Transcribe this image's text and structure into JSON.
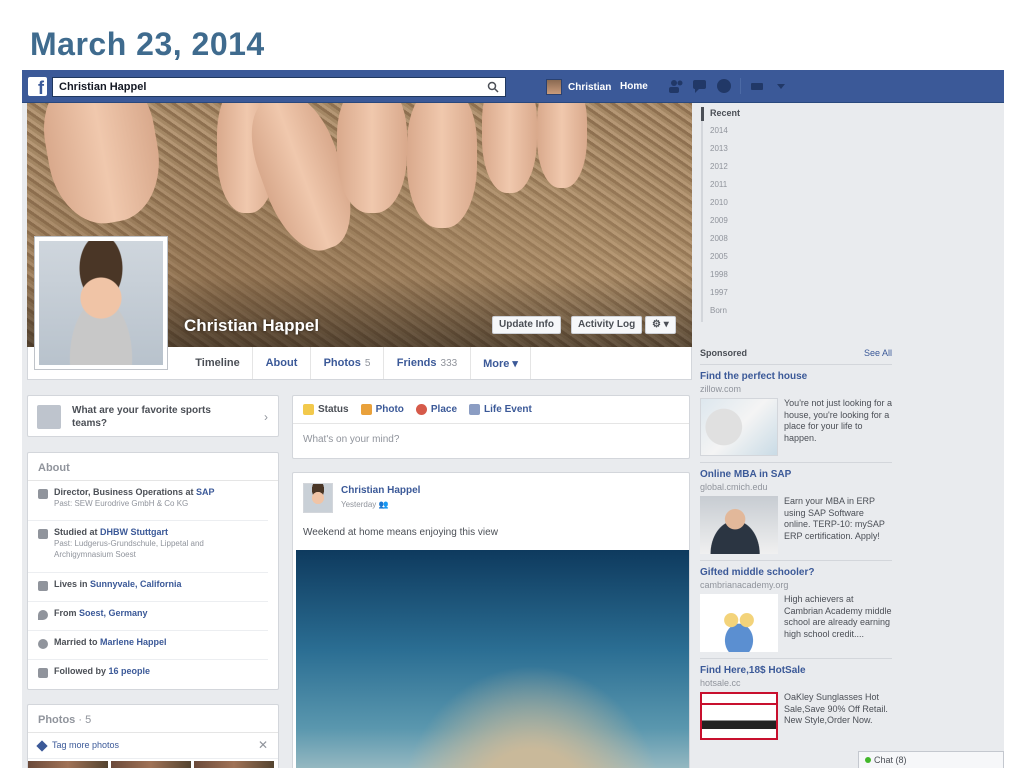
{
  "slide_title": "March 23, 2014",
  "topbar": {
    "logo": "f",
    "search_value": "Christian Happel",
    "user_name": "Christian",
    "home_label": "Home",
    "icons": [
      "friend-requests-icon",
      "messages-icon",
      "notifications-icon",
      "privacy-icon",
      "settings-dropdown-icon"
    ]
  },
  "profile": {
    "name": "Christian Happel",
    "update_info": "Update Info",
    "activity_log": "Activity Log",
    "gear_menu": "⚙ ▾"
  },
  "tabs": [
    {
      "label": "Timeline",
      "count": ""
    },
    {
      "label": "About",
      "count": ""
    },
    {
      "label": "Photos",
      "count": "5"
    },
    {
      "label": "Friends",
      "count": "333"
    },
    {
      "label": "More ▾",
      "count": ""
    }
  ],
  "sports_prompt": "What are your favorite sports teams?",
  "about": {
    "title": "About",
    "rows": [
      {
        "pre": "Director, Business Operations at ",
        "link": "SAP",
        "sub": "Past: SEW Eurodrive GmbH & Co KG"
      },
      {
        "pre": "Studied at ",
        "link": "DHBW Stuttgart",
        "sub": "Past: Ludgerus-Grundschule, Lippetal and Archigymnasium Soest"
      },
      {
        "pre": "Lives in ",
        "link": "Sunnyvale, California",
        "sub": ""
      },
      {
        "pre": "From ",
        "link": "Soest, Germany",
        "sub": ""
      },
      {
        "pre": "Married to ",
        "link": "Marlene Happel",
        "sub": ""
      },
      {
        "pre": "Followed by ",
        "link": "16 people",
        "sub": ""
      }
    ]
  },
  "photos_card": {
    "title": "Photos",
    "count": "· 5",
    "tag_more": "Tag more photos",
    "close": "✕"
  },
  "composer": {
    "tabs": [
      "Status",
      "Photo",
      "Place",
      "Life Event"
    ],
    "placeholder": "What's on your mind?"
  },
  "post": {
    "author": "Christian Happel",
    "time": "Yesterday",
    "message": "Weekend at home means enjoying this view"
  },
  "years": [
    "Recent",
    "2014",
    "2013",
    "2012",
    "2011",
    "2010",
    "2009",
    "2008",
    "2005",
    "1998",
    "1997",
    "Born"
  ],
  "sponsored": {
    "label": "Sponsored",
    "see_all": "See All",
    "ads": [
      {
        "title": "Find the perfect house",
        "domain": "zillow.com",
        "desc": "You're not just looking for a house, you're looking for a place for your life to happen."
      },
      {
        "title": "Online MBA in SAP",
        "domain": "global.cmich.edu",
        "desc": "Earn your MBA in ERP using SAP Software online. TERP-10: mySAP ERP certification. Apply!"
      },
      {
        "title": "Gifted middle schooler?",
        "domain": "cambrianacademy.org",
        "desc": "High achievers at Cambrian Academy middle school are already earning high school credit...."
      },
      {
        "title": "Find Here,18$ HotSale",
        "domain": "hotsale.cc",
        "desc": "OaKley Sunglasses Hot Sale,Save 90% Off Retail. New Style,Order Now."
      }
    ]
  },
  "chat": {
    "label": "Chat (8)"
  },
  "colors": {
    "brand": "#3b5998",
    "title": "#3f6b8e",
    "online": "#42b72a"
  }
}
